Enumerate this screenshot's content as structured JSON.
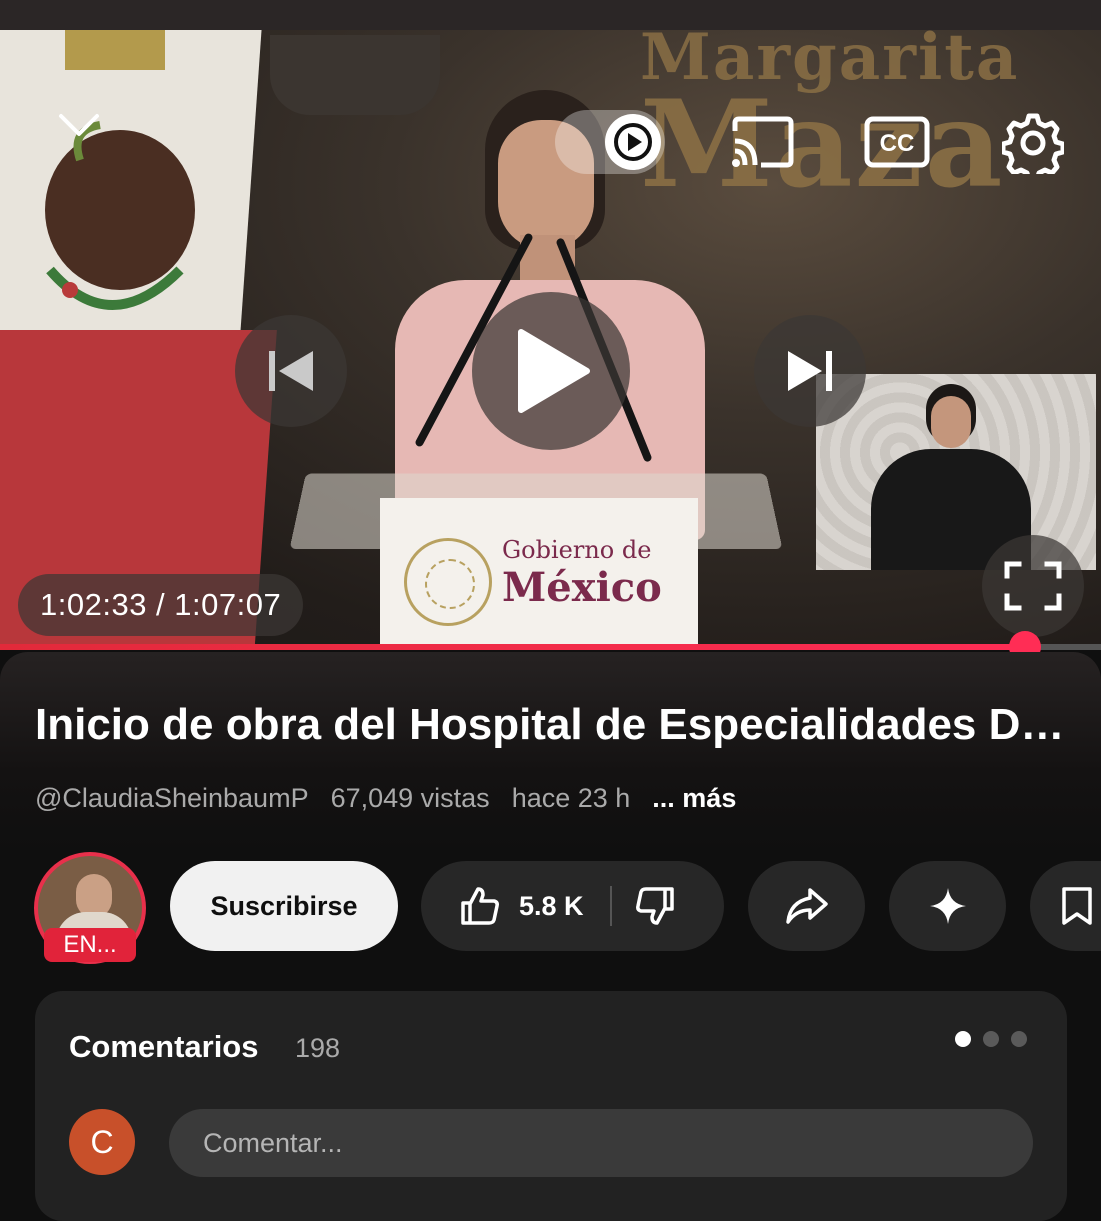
{
  "player": {
    "current_time": "1:02:33",
    "duration": "1:07:07",
    "time_display": "1:02:33 / 1:07:07",
    "progress_fraction": 0.931,
    "controls": {
      "minimize_icon": "chevron-down-icon",
      "autoplay_icon": "play-toggle-icon",
      "cast_icon": "cast-icon",
      "captions_icon": "cc-icon",
      "captions_label": "CC",
      "settings_icon": "gear-icon",
      "previous_icon": "skip-previous-icon",
      "play_icon": "play-icon",
      "next_icon": "skip-next-icon",
      "fullscreen_icon": "fullscreen-icon"
    },
    "frame_text": {
      "backdrop_line1": "Margarita",
      "backdrop_line2": "Maza",
      "podium_line1": "Gobierno de",
      "podium_line2": "México"
    }
  },
  "video": {
    "title": "Inicio de obra del Hospital de Especialidades Dra. Margarita Maza",
    "channel_handle": "@ClaudiaSheinbaumP",
    "views": "67,049 vistas",
    "age": "hace 23 h",
    "more_label": "... más"
  },
  "channel": {
    "live_badge": "EN...",
    "subscribe_label": "Suscribirse"
  },
  "actions": {
    "like_count": "5.8 K",
    "like_icon": "thumbs-up-icon",
    "dislike_icon": "thumbs-down-icon",
    "share_icon": "share-icon",
    "ask_icon": "sparkle-icon",
    "save_icon": "bookmark-icon"
  },
  "comments": {
    "heading": "Comentarios",
    "count": "198",
    "user_initial": "C",
    "input_placeholder": "Comentar..."
  },
  "colors": {
    "accent": "#ff2d55",
    "background": "#0f0f0f",
    "live_badge": "#e1233a",
    "comment_avatar": "#c8502a"
  }
}
